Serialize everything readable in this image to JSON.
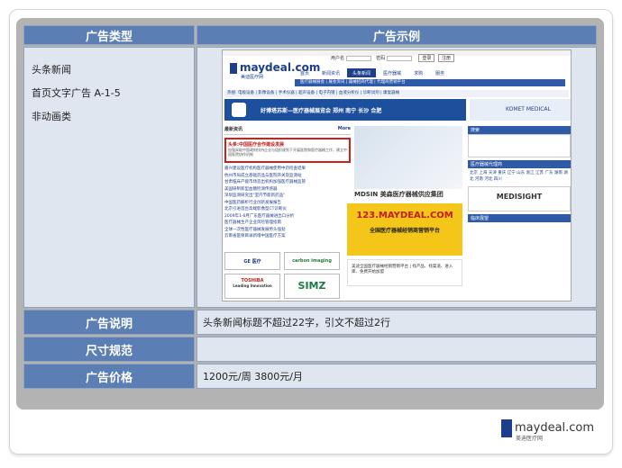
{
  "table": {
    "header_type": "广告类型",
    "header_sample": "广告示例",
    "type_lines": [
      "头条新闻",
      "首页文字广告 A-1-5",
      "非动画类"
    ],
    "rows": [
      {
        "label": "广告说明",
        "value": "头条新闻标题不超过22字，引文不超过2行"
      },
      {
        "label": "尺寸规范",
        "value": ""
      },
      {
        "label": "广告价格",
        "value": "1200元/周  3800元/月"
      }
    ]
  },
  "sample": {
    "logo": "maydeal.com",
    "logo_sub": "美迪医疗网",
    "login_user": "用户名",
    "login_pass": "密码",
    "btn_login": "登录",
    "btn_register": "注册",
    "nav": [
      "首页",
      "新闻资讯",
      "头条新闻",
      "医疗器械",
      "求购",
      "服务"
    ],
    "subnav": "医疗器械展会 | 展会资讯 | 器械招商代理 | 代理商营销平台",
    "hotwords": "热搜: 电极设备 | 影像设备 | 手术仪器 | 超声设备 | 电子内镜 | 血液分析仪 | 诊断试剂 | 康复器械",
    "banner": "好博塔苏斯—医疗器械展览会  郑州 南宁 长沙 合肥",
    "komet": "KOMET MEDICAL",
    "news_title": "最新资讯",
    "more": "More",
    "headline": "头条:中国医疗合作建设发展",
    "headline_desc": "加强采取中国政府扶持企业与组织规划下开展医院和医疗器械工作，建立中国医院协作机制",
    "news_list": [
      "嘉兴建设医疗机构医疗器械使用中药检查结果",
      "杭州市局成立基础药品与医院开关及监测站",
      "甘肃临床产能市场造出机构加强医疗器械监管",
      "美国研制新型血糖检测传感器",
      "深圳监测研究出\"室内节能新药品\"",
      "中国医药解析行业创新发展报告",
      "北京引进首台高端影像型CT诊断仪",
      "2009年1-6月广东医疗器械进出口分析",
      "医疗器械生产企业风险管理指南",
      "全球一次性医疗器械发展势头强劲",
      "云南省医保目录新增中国医疗方案"
    ],
    "logo_ge": "GE 医疗",
    "logo_carbon": "carbon imaging",
    "logo_toshiba": "TOSHIBA",
    "logo_toshiba_sub": "Leading Innovation",
    "logo_simz": "SIMZ",
    "mdsin": "MDSIN 美森医疗器械供应集团",
    "ad_site": "123.MAYDEAL.COM",
    "ad_slogan": "全国医疗器械经销商营销平台",
    "platform": "美迪全国医疗器械经销营销平台 | 找产品、找渠道、进入库、免费开始加盟",
    "right_search": "搜索",
    "right_region_title": "医疗器械代理商",
    "right_regions": "北京 上海 天津 重庆 辽宁 山东 浙江 江苏 广东 湖南 湖北 河南 河北 四川",
    "medsight": "MEDISIGHT",
    "right_news_title": "临床展望"
  },
  "footer": {
    "site": "maydeal.com",
    "sub": "美迪医疗网"
  },
  "colors": {
    "header_blue": "#5b7fb4",
    "cell_bg": "#dfe6f0",
    "panel_gray": "#b3b3b3",
    "highlight_red": "#d0201c",
    "ad_yellow": "#f5c61a"
  }
}
